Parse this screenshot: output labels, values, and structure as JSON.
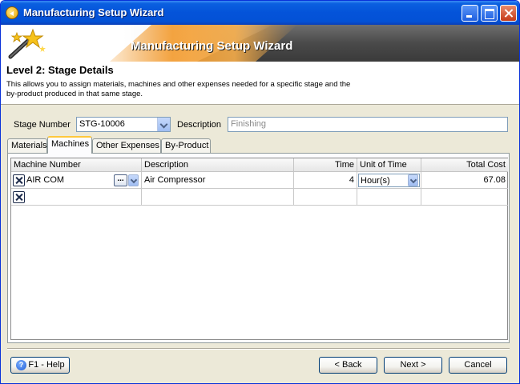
{
  "window": {
    "title": "Manufacturing Setup Wizard"
  },
  "banner": {
    "title": "Manufacturing Setup Wizard"
  },
  "header": {
    "level_title": "Level 2: Stage Details",
    "description_line1": "This allows you to assign materials, machines and other expenses needed for a specific stage and the",
    "description_line2": "by-product produced in that same stage."
  },
  "form": {
    "stage_number_label": "Stage Number",
    "stage_number_value": "STG-10006",
    "description_label": "Description",
    "description_value": "Finishing"
  },
  "tabs": [
    {
      "label": "Materials",
      "active": false
    },
    {
      "label": "Machines",
      "active": true
    },
    {
      "label": "Other Expenses",
      "active": false
    },
    {
      "label": "By-Product",
      "active": false
    }
  ],
  "grid": {
    "columns": [
      "Machine Number",
      "Description",
      "Time",
      "Unit of Time",
      "Total Cost"
    ],
    "rows": [
      {
        "machine_number": "AIR COM",
        "description": "Air Compressor",
        "time": "4",
        "unit_of_time": "Hour(s)",
        "total_cost": "67.08"
      }
    ]
  },
  "buttons": {
    "help": "F1 - Help",
    "back": "< Back",
    "next": "Next >",
    "cancel": "Cancel"
  },
  "colors": {
    "title_bar": "#0453d9",
    "accent": "#f39a2c",
    "tab_highlight": "#ffc83c"
  }
}
